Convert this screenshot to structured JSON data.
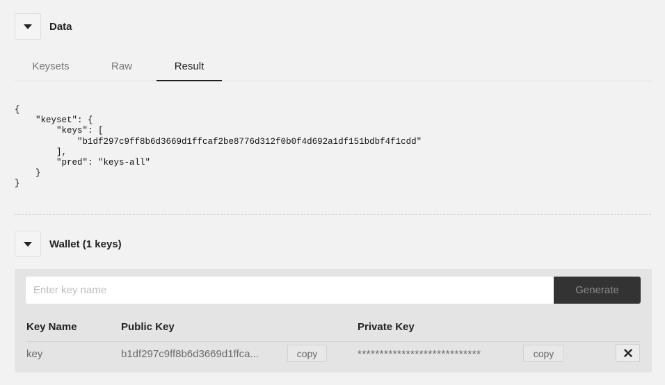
{
  "data_section": {
    "title": "Data",
    "tabs": [
      {
        "label": "Keysets",
        "active": false
      },
      {
        "label": "Raw",
        "active": false
      },
      {
        "label": "Result",
        "active": true
      }
    ],
    "result_json": "{\n    \"keyset\": {\n        \"keys\": [\n            \"b1df297c9ff8b6d3669d1ffcaf2be8776d312f0b0f4d692a1df151bdbf4f1cdd\"\n        ],\n        \"pred\": \"keys-all\"\n    }\n}"
  },
  "wallet_section": {
    "title": "Wallet (1 keys)",
    "key_name_placeholder": "Enter key name",
    "key_name_value": "",
    "generate_label": "Generate",
    "columns": [
      "Key Name",
      "Public Key",
      "Private Key"
    ],
    "rows": [
      {
        "key_name": "key",
        "public_key": "b1df297c9ff8b6d3669d1ffca...",
        "private_key": "****************************",
        "copy_public_label": "copy",
        "copy_private_label": "copy",
        "delete_icon": "close-icon"
      }
    ]
  }
}
